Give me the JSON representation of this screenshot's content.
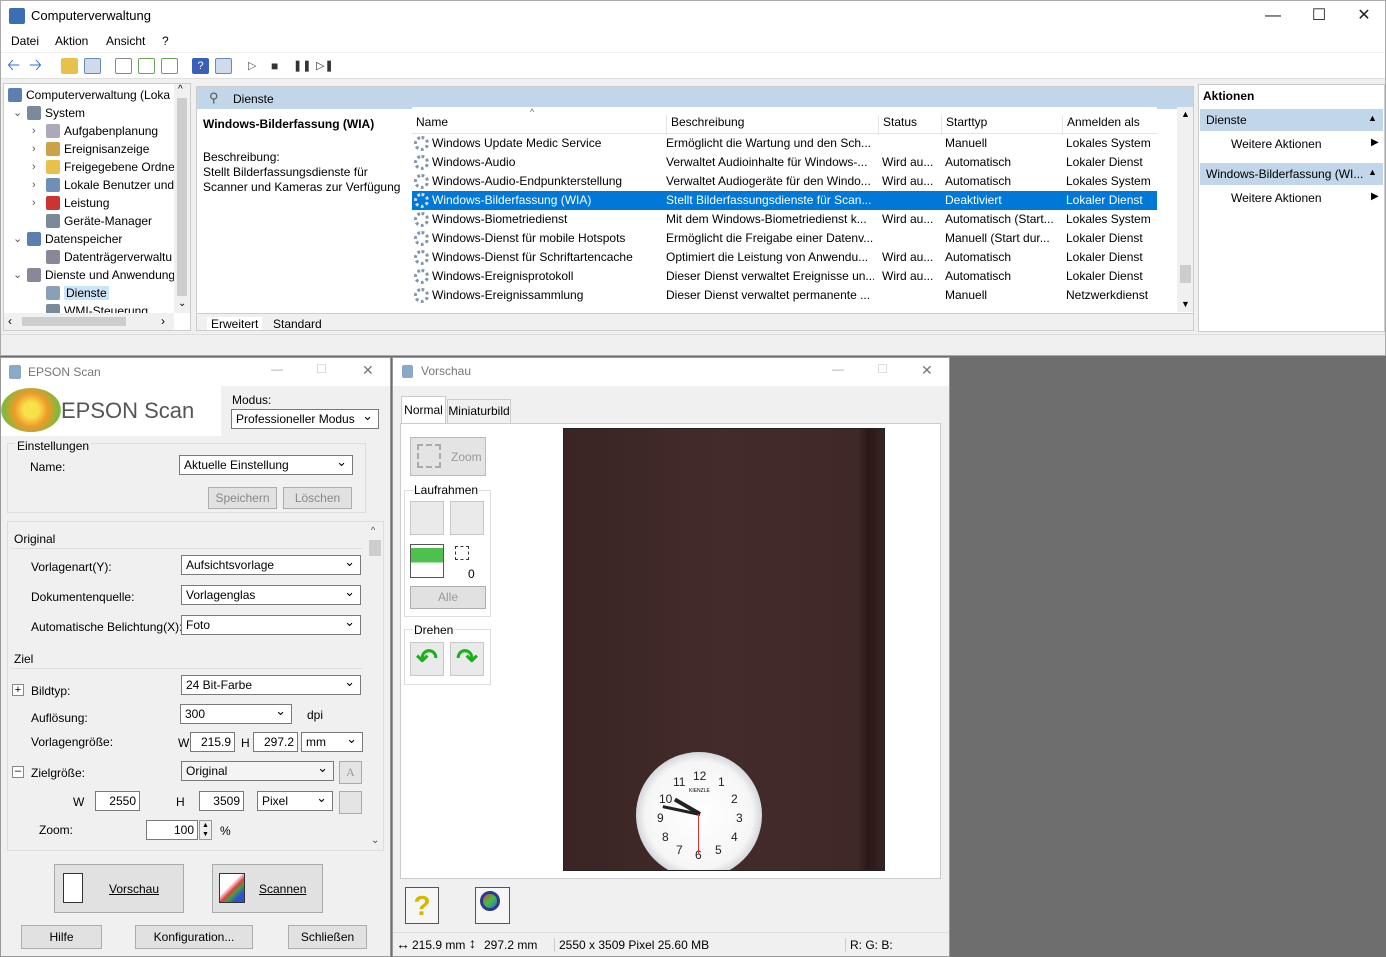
{
  "cm": {
    "title": "Computerverwaltung",
    "menu": [
      "Datei",
      "Aktion",
      "Ansicht",
      "?"
    ],
    "tree": [
      {
        "label": "Computerverwaltung (Loka",
        "indent": 0,
        "exp": "",
        "icon": "computer-icon"
      },
      {
        "label": "System",
        "indent": 1,
        "exp": "v",
        "icon": "tools-icon"
      },
      {
        "label": "Aufgabenplanung",
        "indent": 2,
        "exp": ">",
        "icon": "clock-icon"
      },
      {
        "label": "Ereignisanzeige",
        "indent": 2,
        "exp": ">",
        "icon": "event-icon"
      },
      {
        "label": "Freigegebene Ordne",
        "indent": 2,
        "exp": ">",
        "icon": "folder-icon"
      },
      {
        "label": "Lokale Benutzer und",
        "indent": 2,
        "exp": ">",
        "icon": "users-icon"
      },
      {
        "label": "Leistung",
        "indent": 2,
        "exp": ">",
        "icon": "performance-icon"
      },
      {
        "label": "Geräte-Manager",
        "indent": 2,
        "exp": "",
        "icon": "device-icon"
      },
      {
        "label": "Datenspeicher",
        "indent": 1,
        "exp": "v",
        "icon": "storage-icon"
      },
      {
        "label": "Datenträgerverwaltu",
        "indent": 2,
        "exp": "",
        "icon": "disk-icon"
      },
      {
        "label": "Dienste und Anwendung",
        "indent": 1,
        "exp": "v",
        "icon": "services-icon"
      },
      {
        "label": "Dienste",
        "indent": 2,
        "exp": "",
        "icon": "gear-icon",
        "sel": true
      },
      {
        "label": "WMI-Steuerung",
        "indent": 2,
        "exp": "",
        "icon": "wmi-icon"
      }
    ],
    "panel_title": "Dienste",
    "detail_title": "Windows-Bilderfassung (WIA)",
    "detail_desc_label": "Beschreibung:",
    "detail_desc": "Stellt Bilderfassungsdienste für Scanner und Kameras zur Verfügung",
    "columns": [
      "Name",
      "Beschreibung",
      "Status",
      "Starttyp",
      "Anmelden als"
    ],
    "rows": [
      [
        "Windows Update Medic Service",
        "Ermöglicht die Wartung und den Sch...",
        "",
        "Manuell",
        "Lokales System"
      ],
      [
        "Windows-Audio",
        "Verwaltet Audioinhalte für Windows-...",
        "Wird au...",
        "Automatisch",
        "Lokaler Dienst"
      ],
      [
        "Windows-Audio-Endpunkterstellung",
        "Verwaltet Audiogeräte für den Windo...",
        "Wird au...",
        "Automatisch",
        "Lokales System"
      ],
      [
        "Windows-Bilderfassung (WIA)",
        "Stellt Bilderfassungsdienste für Scan...",
        "",
        "Deaktiviert",
        "Lokaler Dienst"
      ],
      [
        "Windows-Biometriedienst",
        "Mit dem Windows-Biometriedienst k...",
        "Wird au...",
        "Automatisch (Start...",
        "Lokales System"
      ],
      [
        "Windows-Dienst für mobile Hotspots",
        "Ermöglicht die Freigabe einer Datenv...",
        "",
        "Manuell (Start dur...",
        "Lokaler Dienst"
      ],
      [
        "Windows-Dienst für Schriftartencache",
        "Optimiert die Leistung von Anwendu...",
        "Wird au...",
        "Automatisch",
        "Lokaler Dienst"
      ],
      [
        "Windows-Ereignisprotokoll",
        "Dieser Dienst verwaltet Ereignisse un...",
        "Wird au...",
        "Automatisch",
        "Lokaler Dienst"
      ],
      [
        "Windows-Ereignissammlung",
        "Dieser Dienst verwaltet permanente ...",
        "",
        "Manuell",
        "Netzwerkdienst"
      ]
    ],
    "tabs": [
      "Erweitert",
      "Standard"
    ],
    "actions_title": "Aktionen",
    "actions_group1": "Dienste",
    "actions_group2": "Windows-Bilderfassung (WI...",
    "more_actions": "Weitere Aktionen"
  },
  "ep": {
    "title": "EPSON Scan",
    "logo": "EPSON Scan",
    "mode_label": "Modus:",
    "mode_value": "Professioneller Modus",
    "settings_group": "Einstellungen",
    "name_label": "Name:",
    "name_value": "Aktuelle Einstellung",
    "save": "Speichern",
    "delete": "Löschen",
    "original": "Original",
    "doc_type_label": "Vorlagenart(Y):",
    "doc_type": "Aufsichtsvorlage",
    "doc_source_label": "Dokumentenquelle:",
    "doc_source": "Vorlagenglas",
    "auto_exp_label": "Automatische Belichtung(X):",
    "auto_exp": "Foto",
    "target": "Ziel",
    "image_type_label": "Bildtyp:",
    "image_type": "24 Bit-Farbe",
    "resolution_label": "Auflösung:",
    "resolution": "300",
    "dpi": "dpi",
    "doc_size_label": "Vorlagengröße:",
    "w": "W",
    "h": "H",
    "doc_w": "215.9",
    "doc_h": "297.2",
    "unit": "mm",
    "target_size_label": "Zielgröße:",
    "target_size": "Original",
    "tw": "2550",
    "th": "3509",
    "tunit": "Pixel",
    "zoom_label": "Zoom:",
    "zoom": "100",
    "percent": "%",
    "preview": "Vorschau",
    "scan": "Scannen",
    "help": "Hilfe",
    "config": "Konfiguration...",
    "close": "Schließen"
  },
  "vs": {
    "title": "Vorschau",
    "tab_normal": "Normal",
    "tab_thumb": "Miniaturbild",
    "zoom": "Zoom",
    "marquee": "Laufrahmen",
    "count": "0",
    "all": "Alle",
    "rotate": "Drehen",
    "status_w": "215.9 mm",
    "status_h": "297.2 mm",
    "status_px": "2550 x 3509 Pixel 25.60 MB",
    "status_rgb": "R: G: B:",
    "clock_brand": "KIENZLE",
    "clock_numbers": [
      "12",
      "1",
      "2",
      "3",
      "4",
      "5",
      "6",
      "7",
      "8",
      "9",
      "10",
      "11"
    ]
  }
}
